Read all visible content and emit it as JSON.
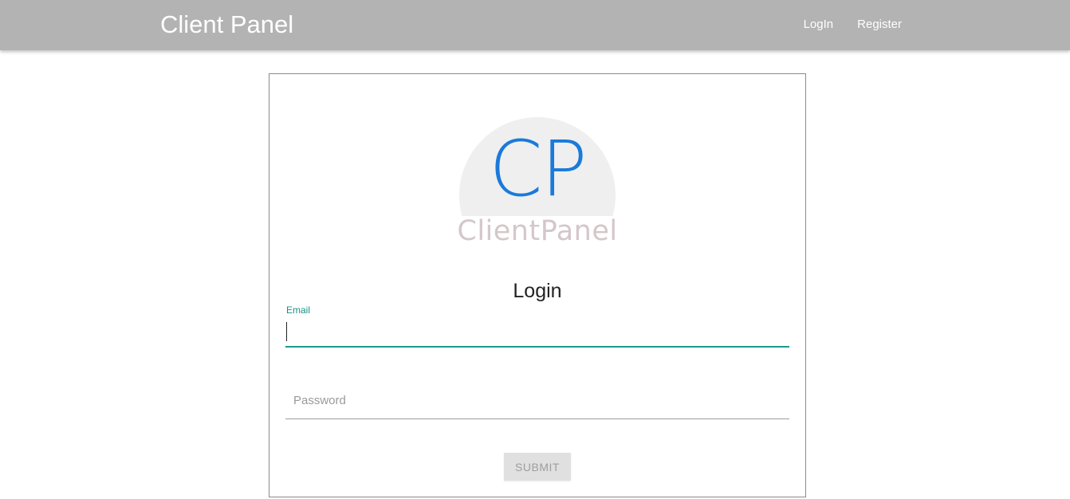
{
  "navbar": {
    "brand": "Client Panel",
    "links": [
      {
        "label": "LogIn"
      },
      {
        "label": "Register"
      }
    ],
    "background_color": "#b3b3b3"
  },
  "logo": {
    "monogram": "CP",
    "wordmark": "ClientPanel",
    "monogram_color": "#1a7ad9",
    "wordmark_color": "#d4c7ca"
  },
  "login_form": {
    "title": "Login",
    "email": {
      "label": "Email",
      "value": ""
    },
    "password": {
      "placeholder": "Password",
      "value": ""
    },
    "submit_label": "SUBMIT",
    "accent_color": "#1b9a8c"
  }
}
